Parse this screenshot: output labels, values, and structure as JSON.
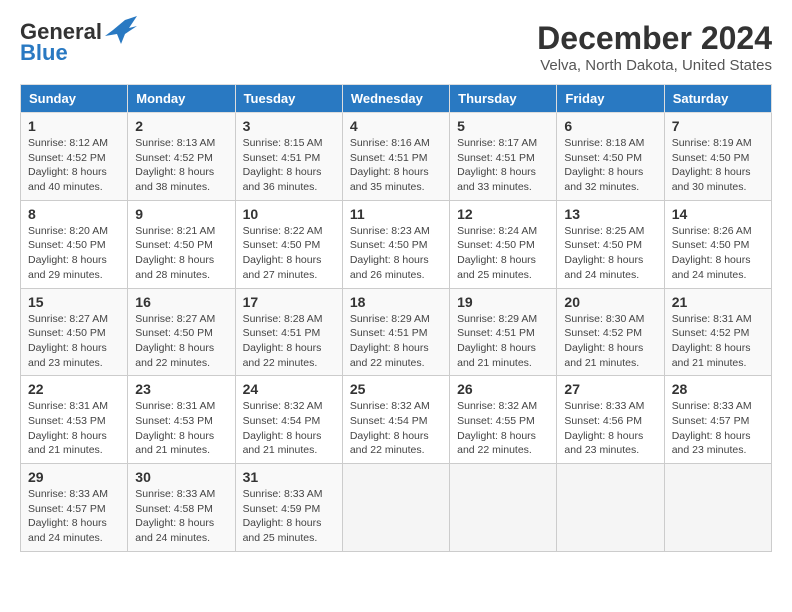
{
  "logo": {
    "line1": "General",
    "line2": "Blue"
  },
  "title": "December 2024",
  "location": "Velva, North Dakota, United States",
  "days_of_week": [
    "Sunday",
    "Monday",
    "Tuesday",
    "Wednesday",
    "Thursday",
    "Friday",
    "Saturday"
  ],
  "weeks": [
    [
      {
        "day": "1",
        "sunrise": "8:12 AM",
        "sunset": "4:52 PM",
        "daylight": "8 hours and 40 minutes."
      },
      {
        "day": "2",
        "sunrise": "8:13 AM",
        "sunset": "4:52 PM",
        "daylight": "8 hours and 38 minutes."
      },
      {
        "day": "3",
        "sunrise": "8:15 AM",
        "sunset": "4:51 PM",
        "daylight": "8 hours and 36 minutes."
      },
      {
        "day": "4",
        "sunrise": "8:16 AM",
        "sunset": "4:51 PM",
        "daylight": "8 hours and 35 minutes."
      },
      {
        "day": "5",
        "sunrise": "8:17 AM",
        "sunset": "4:51 PM",
        "daylight": "8 hours and 33 minutes."
      },
      {
        "day": "6",
        "sunrise": "8:18 AM",
        "sunset": "4:50 PM",
        "daylight": "8 hours and 32 minutes."
      },
      {
        "day": "7",
        "sunrise": "8:19 AM",
        "sunset": "4:50 PM",
        "daylight": "8 hours and 30 minutes."
      }
    ],
    [
      {
        "day": "8",
        "sunrise": "8:20 AM",
        "sunset": "4:50 PM",
        "daylight": "8 hours and 29 minutes."
      },
      {
        "day": "9",
        "sunrise": "8:21 AM",
        "sunset": "4:50 PM",
        "daylight": "8 hours and 28 minutes."
      },
      {
        "day": "10",
        "sunrise": "8:22 AM",
        "sunset": "4:50 PM",
        "daylight": "8 hours and 27 minutes."
      },
      {
        "day": "11",
        "sunrise": "8:23 AM",
        "sunset": "4:50 PM",
        "daylight": "8 hours and 26 minutes."
      },
      {
        "day": "12",
        "sunrise": "8:24 AM",
        "sunset": "4:50 PM",
        "daylight": "8 hours and 25 minutes."
      },
      {
        "day": "13",
        "sunrise": "8:25 AM",
        "sunset": "4:50 PM",
        "daylight": "8 hours and 24 minutes."
      },
      {
        "day": "14",
        "sunrise": "8:26 AM",
        "sunset": "4:50 PM",
        "daylight": "8 hours and 24 minutes."
      }
    ],
    [
      {
        "day": "15",
        "sunrise": "8:27 AM",
        "sunset": "4:50 PM",
        "daylight": "8 hours and 23 minutes."
      },
      {
        "day": "16",
        "sunrise": "8:27 AM",
        "sunset": "4:50 PM",
        "daylight": "8 hours and 22 minutes."
      },
      {
        "day": "17",
        "sunrise": "8:28 AM",
        "sunset": "4:51 PM",
        "daylight": "8 hours and 22 minutes."
      },
      {
        "day": "18",
        "sunrise": "8:29 AM",
        "sunset": "4:51 PM",
        "daylight": "8 hours and 22 minutes."
      },
      {
        "day": "19",
        "sunrise": "8:29 AM",
        "sunset": "4:51 PM",
        "daylight": "8 hours and 21 minutes."
      },
      {
        "day": "20",
        "sunrise": "8:30 AM",
        "sunset": "4:52 PM",
        "daylight": "8 hours and 21 minutes."
      },
      {
        "day": "21",
        "sunrise": "8:31 AM",
        "sunset": "4:52 PM",
        "daylight": "8 hours and 21 minutes."
      }
    ],
    [
      {
        "day": "22",
        "sunrise": "8:31 AM",
        "sunset": "4:53 PM",
        "daylight": "8 hours and 21 minutes."
      },
      {
        "day": "23",
        "sunrise": "8:31 AM",
        "sunset": "4:53 PM",
        "daylight": "8 hours and 21 minutes."
      },
      {
        "day": "24",
        "sunrise": "8:32 AM",
        "sunset": "4:54 PM",
        "daylight": "8 hours and 21 minutes."
      },
      {
        "day": "25",
        "sunrise": "8:32 AM",
        "sunset": "4:54 PM",
        "daylight": "8 hours and 22 minutes."
      },
      {
        "day": "26",
        "sunrise": "8:32 AM",
        "sunset": "4:55 PM",
        "daylight": "8 hours and 22 minutes."
      },
      {
        "day": "27",
        "sunrise": "8:33 AM",
        "sunset": "4:56 PM",
        "daylight": "8 hours and 23 minutes."
      },
      {
        "day": "28",
        "sunrise": "8:33 AM",
        "sunset": "4:57 PM",
        "daylight": "8 hours and 23 minutes."
      }
    ],
    [
      {
        "day": "29",
        "sunrise": "8:33 AM",
        "sunset": "4:57 PM",
        "daylight": "8 hours and 24 minutes."
      },
      {
        "day": "30",
        "sunrise": "8:33 AM",
        "sunset": "4:58 PM",
        "daylight": "8 hours and 24 minutes."
      },
      {
        "day": "31",
        "sunrise": "8:33 AM",
        "sunset": "4:59 PM",
        "daylight": "8 hours and 25 minutes."
      },
      null,
      null,
      null,
      null
    ]
  ]
}
